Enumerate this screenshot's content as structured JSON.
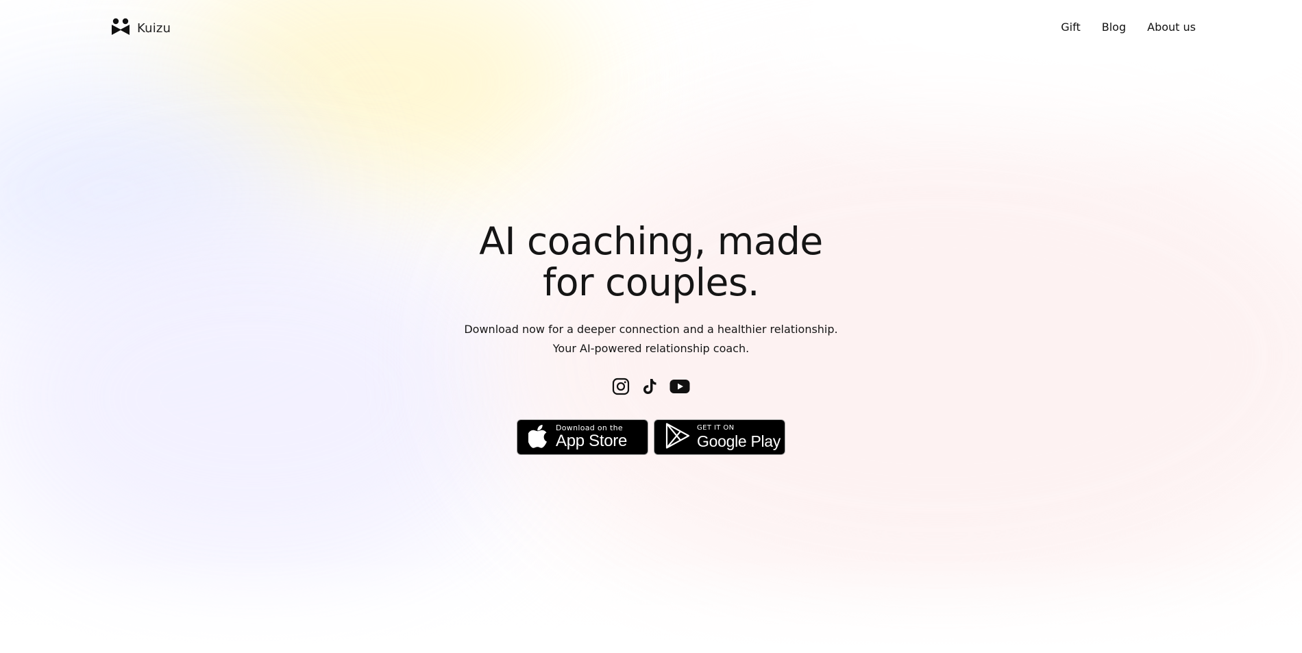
{
  "brand": {
    "name": "Kuizu",
    "icon": "kuizu-logo-icon"
  },
  "nav": {
    "items": [
      {
        "label": "Gift"
      },
      {
        "label": "Blog"
      },
      {
        "label": "About us"
      }
    ]
  },
  "hero": {
    "headline_line1": "AI coaching, made",
    "headline_line2": "for couples.",
    "subtitle_line1": "Download now for a deeper connection and a healthier relationship.",
    "subtitle_line2": "Your AI-powered relationship coach."
  },
  "socials": [
    {
      "icon": "instagram-icon"
    },
    {
      "icon": "tiktok-icon"
    },
    {
      "icon": "youtube-icon"
    }
  ],
  "stores": {
    "app_store": {
      "small": "Download on the",
      "big": "App Store",
      "icon": "apple-icon"
    },
    "google_play": {
      "small": "GET IT ON",
      "big": "Google Play",
      "icon": "google-play-icon"
    }
  },
  "colors": {
    "text": "#111111",
    "button_bg": "#000000",
    "button_text": "#ffffff"
  }
}
